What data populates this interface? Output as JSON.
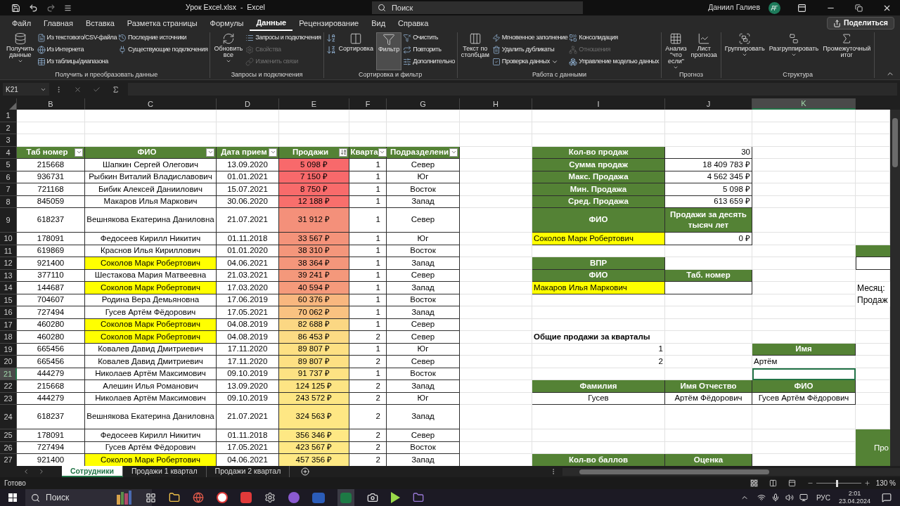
{
  "title_bar": {
    "title": "Урок Excel.xlsx  -  Excel",
    "search_placeholder": "Поиск",
    "user_name": "Даниил Галиев",
    "avatar_initials": "ДГ"
  },
  "menu_tabs": [
    {
      "label": "Файл",
      "selected": false
    },
    {
      "label": "Главная",
      "selected": false
    },
    {
      "label": "Вставка",
      "selected": false
    },
    {
      "label": "Разметка страницы",
      "selected": false
    },
    {
      "label": "Формулы",
      "selected": false
    },
    {
      "label": "Данные",
      "selected": true
    },
    {
      "label": "Рецензирование",
      "selected": false
    },
    {
      "label": "Вид",
      "selected": false
    },
    {
      "label": "Справка",
      "selected": false
    }
  ],
  "share_button": "Поделиться",
  "ribbon_groups": [
    {
      "label": "Получить и преобразовать данные",
      "items": [
        {
          "kind": "large",
          "label": "Получить данные",
          "dropdown": true,
          "disabled": false,
          "selected": false
        },
        {
          "kind": "small",
          "label": "Из текстового/CSV-файла",
          "dropdown": false,
          "disabled": false,
          "selected": false
        },
        {
          "kind": "small",
          "label": "Из Интернета",
          "dropdown": false,
          "disabled": false,
          "selected": false
        },
        {
          "kind": "small",
          "label": "Из таблицы/диапазона",
          "dropdown": false,
          "disabled": false,
          "selected": false
        },
        {
          "kind": "small",
          "label": "Последние источники",
          "dropdown": false,
          "disabled": false,
          "selected": false
        },
        {
          "kind": "small",
          "label": "Существующие подключения",
          "dropdown": false,
          "disabled": false,
          "selected": false
        }
      ]
    },
    {
      "label": "Запросы и подключения",
      "items": [
        {
          "kind": "large",
          "label": "Обновить все",
          "dropdown": true,
          "disabled": false,
          "selected": false
        },
        {
          "kind": "small",
          "label": "Запросы и подключения",
          "dropdown": false,
          "disabled": false,
          "selected": false
        },
        {
          "kind": "small",
          "label": "Свойства",
          "dropdown": false,
          "disabled": true,
          "selected": false
        },
        {
          "kind": "small",
          "label": "Изменить связи",
          "dropdown": false,
          "disabled": true,
          "selected": false
        }
      ]
    },
    {
      "label": "Сортировка и фильтр",
      "items": [
        {
          "kind": "icon",
          "dropdown": false,
          "disabled": false,
          "selected": false
        },
        {
          "kind": "icon",
          "dropdown": false,
          "disabled": false,
          "selected": false
        },
        {
          "kind": "large",
          "label": "Сортировка",
          "dropdown": false,
          "disabled": false,
          "selected": false
        },
        {
          "kind": "large",
          "label": "Фильтр",
          "dropdown": false,
          "disabled": false,
          "selected": true
        },
        {
          "kind": "small",
          "label": "Очистить",
          "dropdown": false,
          "disabled": false,
          "selected": false
        },
        {
          "kind": "small",
          "label": "Повторить",
          "dropdown": false,
          "disabled": false,
          "selected": false
        },
        {
          "kind": "small",
          "label": "Дополнительно",
          "dropdown": false,
          "disabled": false,
          "selected": false
        }
      ]
    },
    {
      "label": "Работа с данными",
      "items": [
        {
          "kind": "large",
          "label": "Текст по столбцам",
          "dropdown": false,
          "disabled": false,
          "selected": false
        },
        {
          "kind": "small",
          "label": "Мгновенное заполнение",
          "dropdown": false,
          "disabled": false,
          "selected": false
        },
        {
          "kind": "small",
          "label": "Удалить дубликаты",
          "dropdown": false,
          "disabled": false,
          "selected": false
        },
        {
          "kind": "small",
          "label": "Проверка данных",
          "dropdown": true,
          "disabled": false,
          "selected": false
        },
        {
          "kind": "small",
          "label": "Консолидация",
          "dropdown": false,
          "disabled": false,
          "selected": false
        },
        {
          "kind": "small",
          "label": "Отношения",
          "dropdown": false,
          "disabled": true,
          "selected": false
        },
        {
          "kind": "small",
          "label": "Управление моделью данных",
          "dropdown": false,
          "disabled": false,
          "selected": false
        }
      ]
    },
    {
      "label": "Прогноз",
      "items": [
        {
          "kind": "large",
          "label": "Анализ \"что если\"",
          "dropdown": true,
          "disabled": false,
          "selected": false
        },
        {
          "kind": "large",
          "label": "Лист прогноза",
          "dropdown": false,
          "disabled": false,
          "selected": false
        }
      ]
    },
    {
      "label": "Структура",
      "items": [
        {
          "kind": "large",
          "label": "Группировать",
          "dropdown": true,
          "disabled": false,
          "selected": false
        },
        {
          "kind": "large",
          "label": "Разгруппировать",
          "dropdown": true,
          "disabled": false,
          "selected": false
        },
        {
          "kind": "large",
          "label": "Промежуточный итог",
          "dropdown": false,
          "disabled": false,
          "selected": false
        }
      ]
    }
  ],
  "formula_bar": {
    "name_box": "K21"
  },
  "column_headers": [
    {
      "label": "B",
      "selected": false
    },
    {
      "label": "C",
      "selected": false
    },
    {
      "label": "D",
      "selected": false
    },
    {
      "label": "E",
      "selected": false
    },
    {
      "label": "F",
      "selected": false
    },
    {
      "label": "G",
      "selected": false
    },
    {
      "label": "H",
      "selected": false
    },
    {
      "label": "I",
      "selected": false
    },
    {
      "label": "J",
      "selected": false
    },
    {
      "label": "K",
      "selected": true
    }
  ],
  "row_headers": [
    {
      "label": "1",
      "selected": false
    },
    {
      "label": "2",
      "selected": false
    },
    {
      "label": "3",
      "selected": false
    },
    {
      "label": "4",
      "selected": false
    },
    {
      "label": "5",
      "selected": false
    },
    {
      "label": "6",
      "selected": false
    },
    {
      "label": "7",
      "selected": false
    },
    {
      "label": "8",
      "selected": false
    },
    {
      "label": "9",
      "selected": false
    },
    {
      "label": "10",
      "selected": false
    },
    {
      "label": "11",
      "selected": false
    },
    {
      "label": "12",
      "selected": false
    },
    {
      "label": "13",
      "selected": false
    },
    {
      "label": "14",
      "selected": false
    },
    {
      "label": "15",
      "selected": false
    },
    {
      "label": "16",
      "selected": false
    },
    {
      "label": "17",
      "selected": false
    },
    {
      "label": "18",
      "selected": false
    },
    {
      "label": "19",
      "selected": false
    },
    {
      "label": "20",
      "selected": false
    },
    {
      "label": "21",
      "selected": true
    },
    {
      "label": "22",
      "selected": false
    },
    {
      "label": "23",
      "selected": false
    },
    {
      "label": "24",
      "selected": false
    },
    {
      "label": "25",
      "selected": false
    },
    {
      "label": "26",
      "selected": false
    },
    {
      "label": "27",
      "selected": false
    }
  ],
  "employees_table": {
    "columns": [
      {
        "label": "Таб номер",
        "sorted": false
      },
      {
        "label": "ФИО",
        "sorted": false
      },
      {
        "label": "Дата прием",
        "sorted": false
      },
      {
        "label": "Продажи",
        "sorted": true
      },
      {
        "label": "Кварта",
        "sorted": false
      },
      {
        "label": "Подразделени",
        "sorted": false
      }
    ],
    "rows": [
      {
        "tab": "215668",
        "fio": "Шапкин Сергей Олегович",
        "highlighted": false,
        "date": "13.09.2020",
        "sales": "5 098 ₽",
        "color": "#f8696b",
        "quarter": "1",
        "division": "Север"
      },
      {
        "tab": "936731",
        "fio": "Рыбкин Виталий Владиславович",
        "highlighted": false,
        "date": "01.01.2021",
        "sales": "7 150 ₽",
        "color": "#f8696b",
        "quarter": "1",
        "division": "Юг"
      },
      {
        "tab": "721168",
        "fio": "Бибик Алексей Даниилович",
        "highlighted": false,
        "date": "15.07.2021",
        "sales": "8 750 ₽",
        "color": "#f86b6b",
        "quarter": "1",
        "division": "Восток"
      },
      {
        "tab": "845059",
        "fio": "Макаров Илья Маркович",
        "highlighted": false,
        "date": "30.06.2020",
        "sales": "12 188 ₽",
        "color": "#f86f6c",
        "quarter": "1",
        "division": "Запад"
      },
      {
        "tab": "618237",
        "fio": "Вешнякова Екатерина Даниловна",
        "highlighted": false,
        "date": "21.07.2021",
        "sales": "31 912 ₽",
        "color": "#f4907a",
        "quarter": "1",
        "division": "Север"
      },
      {
        "tab": "178091",
        "fio": "Федосеев Кирилл Никитич",
        "highlighted": false,
        "date": "01.11.2018",
        "sales": "33 567 ₽",
        "color": "#f4937a",
        "quarter": "1",
        "division": "Юг"
      },
      {
        "tab": "619869",
        "fio": "Краснов Илья Кириллович",
        "highlighted": false,
        "date": "01.01.2020",
        "sales": "38 310 ₽",
        "color": "#f4967b",
        "quarter": "1",
        "division": "Восток"
      },
      {
        "tab": "921400",
        "fio": "Соколов Марк Робертович",
        "highlighted": true,
        "date": "04.06.2021",
        "sales": "38 364 ₽",
        "color": "#f4967b",
        "quarter": "1",
        "division": "Запад"
      },
      {
        "tab": "377110",
        "fio": "Шестакова Мария Матвеевна",
        "highlighted": false,
        "date": "21.03.2021",
        "sales": "39 241 ₽",
        "color": "#f4987b",
        "quarter": "1",
        "division": "Север"
      },
      {
        "tab": "144687",
        "fio": "Соколов Марк Робертович",
        "highlighted": true,
        "date": "17.03.2020",
        "sales": "40 594 ₽",
        "color": "#f59a7b",
        "quarter": "1",
        "division": "Запад"
      },
      {
        "tab": "704607",
        "fio": "Родина Вера Демьяновна",
        "highlighted": false,
        "date": "17.06.2019",
        "sales": "60 376 ₽",
        "color": "#f8b77f",
        "quarter": "1",
        "division": "Восток"
      },
      {
        "tab": "727494",
        "fio": "Гусев Артём Фёдорович",
        "highlighted": false,
        "date": "17.05.2021",
        "sales": "70 062 ₽",
        "color": "#f9c281",
        "quarter": "1",
        "division": "Запад"
      },
      {
        "tab": "460280",
        "fio": "Соколов Марк Робертович",
        "highlighted": true,
        "date": "04.08.2019",
        "sales": "82 688 ₽",
        "color": "#fbd783",
        "quarter": "1",
        "division": "Север"
      },
      {
        "tab": "460280",
        "fio": "Соколов Марк Робертович",
        "highlighted": true,
        "date": "04.08.2019",
        "sales": "86 453 ₽",
        "color": "#fcdb84",
        "quarter": "2",
        "division": "Север"
      },
      {
        "tab": "665456",
        "fio": "Ковалев Давид Дмитриевич",
        "highlighted": false,
        "date": "17.11.2020",
        "sales": "89 807 ₽",
        "color": "#fde083",
        "quarter": "1",
        "division": "Юг"
      },
      {
        "tab": "665456",
        "fio": "Ковалев Давид Дмитриевич",
        "highlighted": false,
        "date": "17.11.2020",
        "sales": "89 807 ₽",
        "color": "#fde083",
        "quarter": "2",
        "division": "Север"
      },
      {
        "tab": "444279",
        "fio": "Николаев Артём Максимович",
        "highlighted": false,
        "date": "09.10.2019",
        "sales": "91 737 ₽",
        "color": "#fde283",
        "quarter": "1",
        "division": "Восток"
      },
      {
        "tab": "215668",
        "fio": "Алешин Илья Романович",
        "highlighted": false,
        "date": "13.09.2020",
        "sales": "124 125 ₽",
        "color": "#fde484",
        "quarter": "2",
        "division": "Запад"
      },
      {
        "tab": "444279",
        "fio": "Николаев Артём Максимович",
        "highlighted": false,
        "date": "09.10.2019",
        "sales": "243 572 ₽",
        "color": "#fde684",
        "quarter": "2",
        "division": "Юг"
      },
      {
        "tab": "618237",
        "fio": "Вешнякова Екатерина Даниловна",
        "highlighted": false,
        "date": "21.07.2021",
        "sales": "324 563 ₽",
        "color": "#fee784",
        "quarter": "2",
        "division": "Запад"
      },
      {
        "tab": "178091",
        "fio": "Федосеев Кирилл Никитич",
        "highlighted": false,
        "date": "01.11.2018",
        "sales": "356 346 ₽",
        "color": "#fee884",
        "quarter": "2",
        "division": "Север"
      },
      {
        "tab": "727494",
        "fio": "Гусев Артём Фёдорович",
        "highlighted": false,
        "date": "17.05.2021",
        "sales": "423 567 ₽",
        "color": "#fee884",
        "quarter": "2",
        "division": "Восток"
      },
      {
        "tab": "921400",
        "fio": "Соколов Марк Робертович",
        "highlighted": true,
        "date": "04.06.2021",
        "sales": "457 356 ₽",
        "color": "#fee984",
        "quarter": "2",
        "division": "Запад"
      }
    ]
  },
  "summary_table": [
    {
      "label": "Кол-во продаж",
      "value": "30"
    },
    {
      "label": "Сумма продаж",
      "value": "18 409 783 ₽"
    },
    {
      "label": "Макс. Продажа",
      "value": "4 562 345 ₽"
    },
    {
      "label": "Мин. Продажа",
      "value": "5 098 ₽"
    },
    {
      "label": "Сред. Продажа",
      "value": "613 659 ₽"
    }
  ],
  "sumif_table": {
    "headers": [
      "ФИО",
      "Продажи за десять тысяч лет"
    ],
    "fio": "Соколов Марк Робертович",
    "value": "0 ₽"
  },
  "vlookup_table": {
    "title": "ВПР",
    "headers": [
      "ФИО",
      "Таб. номер"
    ],
    "fio": "Макаров Илья Маркович"
  },
  "quarter_totals": {
    "title": "Общие продажи за кварталы",
    "quarters": [
      "1",
      "2"
    ]
  },
  "name_block": {
    "header": "Имя",
    "value": "Артём"
  },
  "split_table": {
    "headers": [
      "Фамилия",
      "Имя Отчество",
      "ФИО"
    ],
    "values": [
      "Гусев",
      "Артём Фёдорович",
      "Гусев Артём Фёдорович"
    ]
  },
  "score_table": {
    "headers": [
      "Кол-во баллов",
      "Оценка"
    ]
  },
  "column_l": {
    "labels": [
      "Месяц:",
      "Продаж"
    ],
    "block_text": "Про"
  },
  "sheet_tabs": [
    {
      "label": "Сотрудники",
      "selected": true
    },
    {
      "label": "Продажи 1 квартал",
      "selected": false
    },
    {
      "label": "Продажи 2 квартал",
      "selected": false
    }
  ],
  "status_bar": {
    "status": "Готово",
    "zoom": "130 %",
    "zoom_slider": {
      "level": 0.45
    }
  },
  "taskbar": {
    "search_placeholder": "Поиск",
    "language": "РУС",
    "time": "2:01",
    "date": "23.04.2024"
  }
}
